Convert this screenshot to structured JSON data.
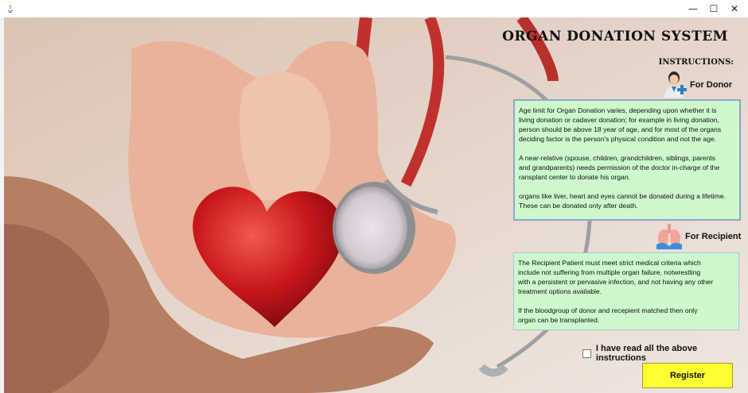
{
  "window": {
    "controls": {
      "minimize": "—",
      "maximize": "☐",
      "close": "✕"
    }
  },
  "header": {
    "title": "ORGAN DONATION SYSTEM",
    "instructions_label": "INSTRUCTIONS:"
  },
  "donor": {
    "label": "For Donor",
    "icon": "doctor-icon",
    "text": "Age limit for Organ Donation varies, depending upon whether it is\nliving donation or cadaver donation; for example in living donation,\nperson should be above 18 year of age, and for most of the organs\ndeciding factor is the person's physical condition and not the age.\n\nA near-relative (spouse, children, grandchildren, siblings, parents\nand grandparents) needs permission of the doctor in-charge of the\nransplant center to donate his organ.\n\norgans like liver, heart and eyes cannot be donated during a lifetime.\n These can be donated only after death."
  },
  "recipient": {
    "label": "For Recipient",
    "icon": "lungs-icon",
    "text": "The Recipient Patient must meet strict medical criteria which\ninclude not suffering from multiple organ failure, notwrestling\nwith a persistent or pervasive infection, and not having any other\ntreatment options available.\n\nIf the bloodgroup of donor and recepient matched then only\norgan can be transplanted."
  },
  "agreement": {
    "label": "I have read all the above instructions",
    "checked": false
  },
  "actions": {
    "register_label": "Register"
  },
  "colors": {
    "info_box": "#ccf8cc",
    "register_button": "#ffff33",
    "heart": "#c8171b"
  }
}
